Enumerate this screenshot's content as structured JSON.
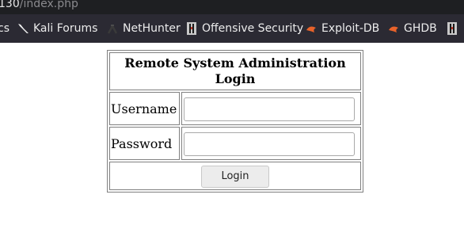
{
  "browser": {
    "url_host": "130",
    "url_path": "/index.php",
    "bookmarks": [
      {
        "label": "cs",
        "icon": "none"
      },
      {
        "label": "Kali Forums",
        "icon": "kali-dragon-icon"
      },
      {
        "label": "NetHunter",
        "icon": "nethunter-icon"
      },
      {
        "label": "Offensive Security",
        "icon": "offsec-icon"
      },
      {
        "label": "Exploit-DB",
        "icon": "exploit-db-icon"
      },
      {
        "label": "GHDB",
        "icon": "ghdb-icon"
      }
    ]
  },
  "login_form": {
    "title": "Remote System Administration Login",
    "username_label": "Username",
    "username_value": "",
    "password_label": "Password",
    "password_value": "",
    "submit_label": "Login"
  },
  "colors": {
    "toolbar_bg": "#2b2a33",
    "urlbar_bg": "#1e1f22",
    "exploit_accent": "#e8622a"
  }
}
